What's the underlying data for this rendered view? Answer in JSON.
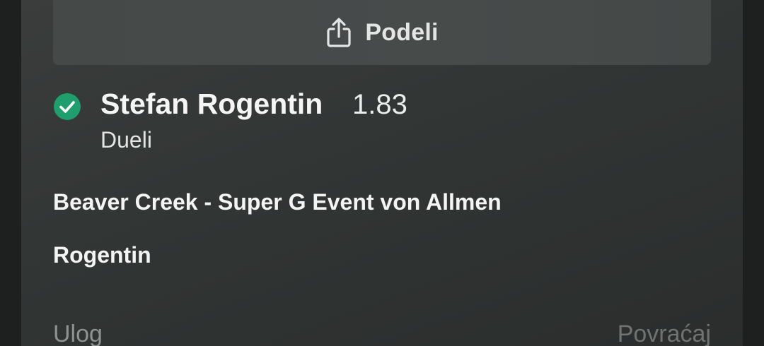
{
  "share": {
    "label": "Podeli",
    "icon": "share-icon"
  },
  "selection": {
    "status_icon": "check-circle-icon",
    "status_color": "#1f9e6e",
    "name": "Stefan Rogentin",
    "odds": "1.83",
    "market": "Dueli"
  },
  "event": {
    "title": "Beaver Creek - Super G Event von Allmen",
    "detail": "Rogentin"
  },
  "footer": {
    "stake_label": "Ulog",
    "cashout_label": "Povraćaj"
  }
}
